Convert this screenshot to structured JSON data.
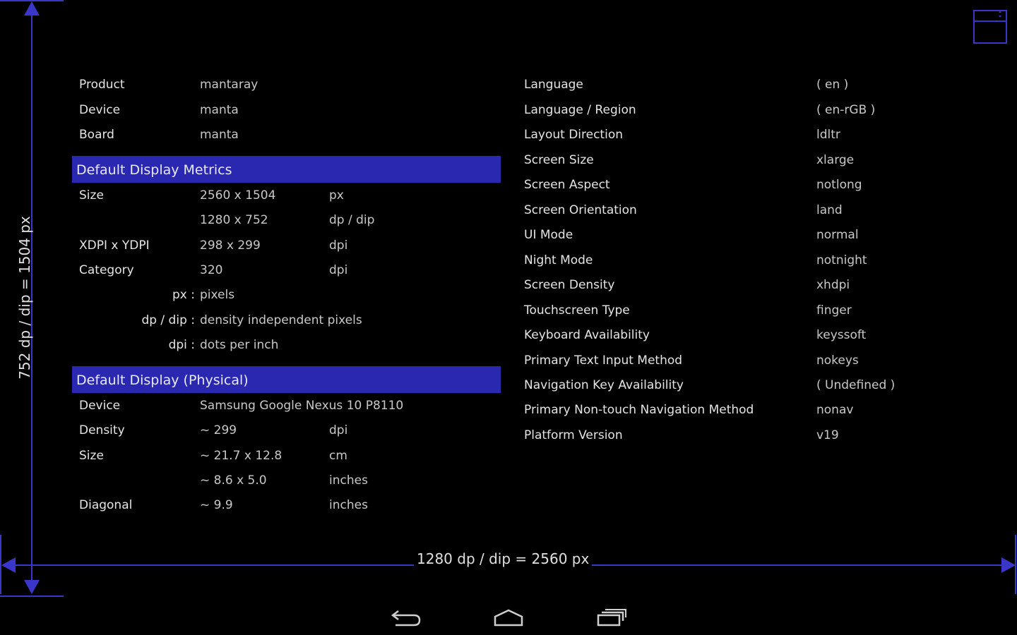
{
  "left_info": [
    {
      "label": "Product",
      "value": "mantaray"
    },
    {
      "label": "Device",
      "value": "manta"
    },
    {
      "label": "Board",
      "value": "manta"
    }
  ],
  "metrics": {
    "header": "Default Display Metrics",
    "rows": [
      {
        "label": "Size",
        "value": "2560 x 1504",
        "unit": "px"
      },
      {
        "label": "",
        "value": "1280 x 752",
        "unit": "dp / dip"
      },
      {
        "label": "XDPI x YDPI",
        "value": "298 x 299",
        "unit": "dpi"
      },
      {
        "label": "Category",
        "value": "320",
        "unit": "dpi"
      }
    ],
    "legend": [
      {
        "key": "px :",
        "desc": "pixels"
      },
      {
        "key": "dp / dip :",
        "desc": "density independent pixels"
      },
      {
        "key": "dpi :",
        "desc": "dots per inch"
      }
    ]
  },
  "physical": {
    "header": "Default Display (Physical)",
    "rows": [
      {
        "label": "Device",
        "value": "Samsung Google Nexus 10 P8110",
        "unit": ""
      },
      {
        "label": "Density",
        "value": "~ 299",
        "unit": "dpi"
      },
      {
        "label": "Size",
        "value": "~ 21.7 x 12.8",
        "unit": "cm"
      },
      {
        "label": "",
        "value": "~ 8.6 x 5.0",
        "unit": "inches"
      },
      {
        "label": "Diagonal",
        "value": "~ 9.9",
        "unit": "inches"
      }
    ]
  },
  "config": [
    {
      "label": "Language",
      "value": "( en )"
    },
    {
      "label": "Language / Region",
      "value": "( en-rGB )"
    },
    {
      "label": "Layout Direction",
      "value": "ldltr"
    },
    {
      "label": "Screen Size",
      "value": "xlarge"
    },
    {
      "label": "Screen Aspect",
      "value": "notlong"
    },
    {
      "label": "Screen Orientation",
      "value": "land"
    },
    {
      "label": "UI Mode",
      "value": "normal"
    },
    {
      "label": "Night Mode",
      "value": "notnight"
    },
    {
      "label": "Screen Density",
      "value": "xhdpi"
    },
    {
      "label": "Touchscreen Type",
      "value": "finger"
    },
    {
      "label": "Keyboard Availability",
      "value": "keyssoft"
    },
    {
      "label": "Primary Text Input Method",
      "value": "nokeys"
    },
    {
      "label": "Navigation Key Availability",
      "value": "( Undefined )"
    },
    {
      "label": "Primary Non-touch Navigation Method",
      "value": "nonav"
    },
    {
      "label": "Platform Version",
      "value": "v19"
    }
  ],
  "measure": {
    "horizontal": "1280 dp / dip   =   2560 px",
    "vertical": "752 dp / dip   =   1504 px"
  },
  "icons": {
    "window_toggle": "window-toggle-icon",
    "back": "back-icon",
    "home": "home-icon",
    "recents": "recents-icon"
  },
  "colors": {
    "accent": "#2a27b0",
    "measure_line": "#3a36c8",
    "background": "#000000"
  }
}
